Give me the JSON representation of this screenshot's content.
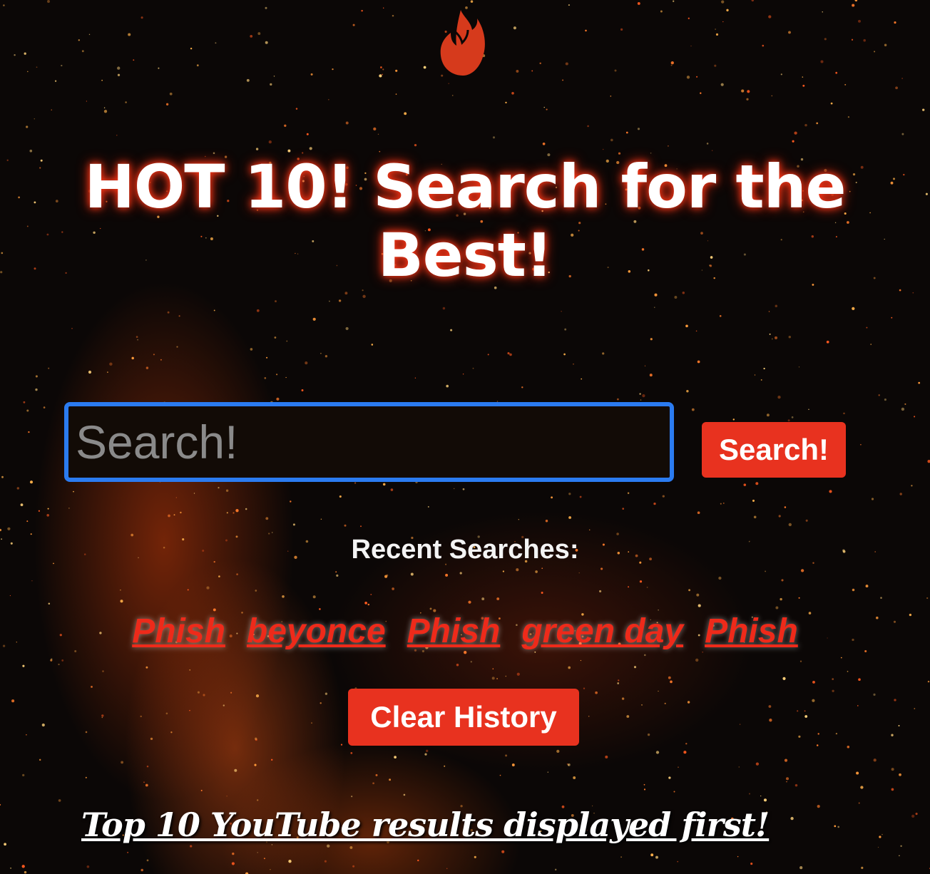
{
  "logo": {
    "icon": "flame-icon",
    "color": "#e8321f"
  },
  "header": {
    "title": "HOT 10! Search for the Best!"
  },
  "search": {
    "placeholder": "Search!",
    "value": "",
    "button_label": "Search!"
  },
  "recent": {
    "title": "Recent Searches:",
    "items": [
      "Phish",
      "beyonce",
      "Phish",
      "green day",
      "Phish"
    ]
  },
  "clear_button_label": "Clear History",
  "footer": {
    "note": "Top 10 YouTube results displayed first!"
  },
  "colors": {
    "accent": "#e8321f",
    "focus_ring": "#2b7bf0",
    "link": "#ee2a1a"
  }
}
